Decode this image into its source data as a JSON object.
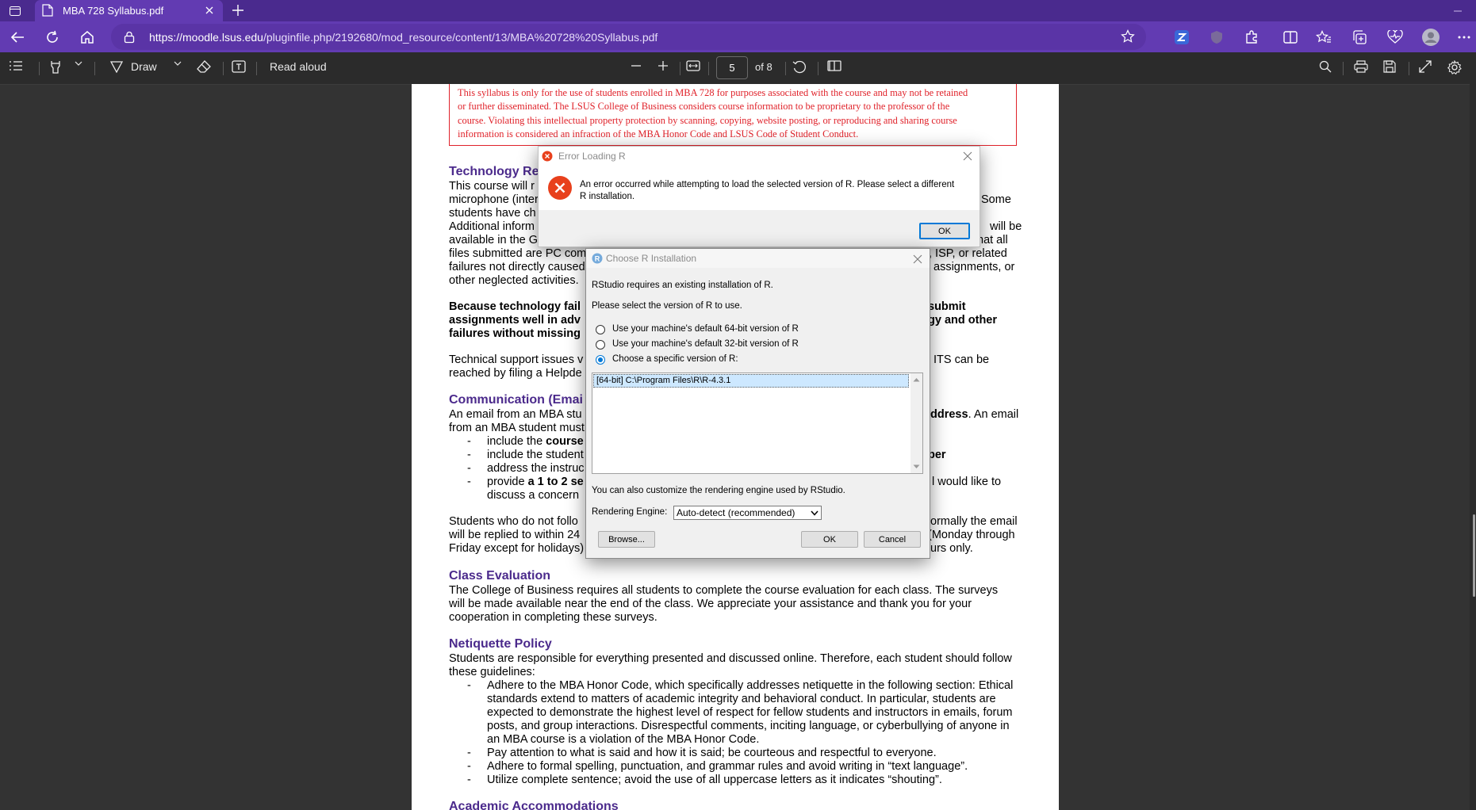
{
  "tab": {
    "title": "MBA 728 Syllabus.pdf"
  },
  "address": {
    "url_host": "https://moodle.lsus.edu",
    "url_path": "/pluginfile.php/2192680/mod_resource/content/13/MBA%20728%20Syllabus.pdf"
  },
  "toolbar": {
    "draw_label": "Draw",
    "read_aloud_label": "Read aloud",
    "page_current": "5",
    "page_total": "of 8"
  },
  "pdf": {
    "notice_lines": [
      "This syllabus is only for the use of students enrolled in MBA 728 for purposes associated with the course and may not be retained",
      "or further disseminated. The LSUS College of Business considers course information to be proprietary to the professor of the",
      "course. Violating this intellectual property protection by scanning, copying, website posting, or reproducing and sharing course",
      "information is considered an infraction of the MBA Honor Code and LSUS Code of Student Conduct."
    ],
    "tech_heading": "Technology Re",
    "tech_left": [
      "This course will r",
      "microphone (inter",
      "students have ch",
      "Additional inform",
      "available in the G",
      "files submitted are PC com",
      "failures not directly caused",
      "other neglected activities."
    ],
    "tech_right": [
      "Some",
      "will be",
      "hat all",
      ", ISP, or related",
      "assignments, or"
    ],
    "bold_left": [
      "Because technology fail",
      "assignments well in adv",
      "failures without missing"
    ],
    "bold_right": [
      "submit",
      "gy and other"
    ],
    "support_left": [
      "Technical support issues v",
      "reached by filing a Helpde"
    ],
    "support_right": "ITS can be",
    "comm_heading": "Communication (Emai",
    "comm_left": [
      "An email from an MBA stu",
      "from an MBA student must"
    ],
    "comm_right_bold": "ddress",
    "comm_right_tail": ". An email",
    "bullet_char": "-",
    "bullets": [
      {
        "pre": "include the ",
        "bold": "course",
        "post": ""
      },
      {
        "pre": "include the student",
        "bold": "",
        "post": ""
      },
      {
        "pre": "address the instruc",
        "bold": "",
        "post": ""
      },
      {
        "pre": "provide ",
        "bold": "a 1 to 2 se",
        "post": ""
      }
    ],
    "bullet_right_1": "ber",
    "bullet_right_2": "l would like to",
    "bullet_cont": "discuss a concern",
    "reply_left": [
      "Students who do not follo",
      "will be replied to within 24",
      "Friday except for holidays)"
    ],
    "reply_right": [
      "ormally the email",
      "(Monday through",
      "urs only."
    ],
    "eval_heading": "Class Evaluation",
    "eval_lines": [
      "The College of Business requires all students to complete the course evaluation for each class. The surveys",
      "will be made available near the end of the class. We appreciate your assistance and thank you for your",
      "cooperation in completing these surveys."
    ],
    "net_heading": "Netiquette Policy",
    "net_lines": [
      "Students are responsible for everything presented and discussed online. Therefore, each student should follow",
      "these guidelines:"
    ],
    "net_bullet1": [
      "Adhere to the MBA Honor Code, which specifically addresses netiquette in the following section: Ethical",
      "standards extend to matters of academic integrity and behavioral conduct. In particular, students are",
      "expected to demonstrate the highest level of respect for fellow students and instructors in emails, forum",
      "posts, and group interactions. Disrespectful comments, inciting language, or cyberbullying of anyone in",
      "an MBA course is a violation of the MBA Honor Code."
    ],
    "net_bullet2": "Pay attention to what is said and how it is said; be courteous and respectful to everyone.",
    "net_bullet3": "Adhere to formal spelling, punctuation, and grammar rules and avoid writing in “text language”.",
    "net_bullet4": "Utilize complete sentence; avoid the use of all uppercase letters as it indicates “shouting”.",
    "acc_heading": "Academic Accommodations"
  },
  "error_dialog": {
    "title": "Error Loading R",
    "message_line1": "An error occurred while attempting to load the selected version of R. Please select a different",
    "message_line2": "R installation.",
    "ok_label": "OK"
  },
  "choose_dialog": {
    "title": "Choose R Installation",
    "line1": "RStudio requires an existing installation of R.",
    "line2": "Please select the version of R to use.",
    "option_64": "Use your machine's default 64-bit version of R",
    "option_32": "Use your machine's default 32-bit version of R",
    "option_specific": "Choose a specific version of R:",
    "list_items": [
      "[64-bit] C:\\Program Files\\R\\R-4.3.1"
    ],
    "engine_note": "You can also customize the rendering engine used by RStudio.",
    "engine_label": "Rendering Engine:",
    "engine_value": "Auto-detect (recommended)",
    "browse_label": "Browse...",
    "ok_label": "OK",
    "cancel_label": "Cancel"
  },
  "colors": {
    "tabstrip": "#4a2a8e",
    "addressbar": "#623bb2",
    "heading_purple": "#4b2a8c",
    "notice_red": "#e0222a",
    "error_red": "#e8401c",
    "accent_blue": "#0078d7"
  }
}
